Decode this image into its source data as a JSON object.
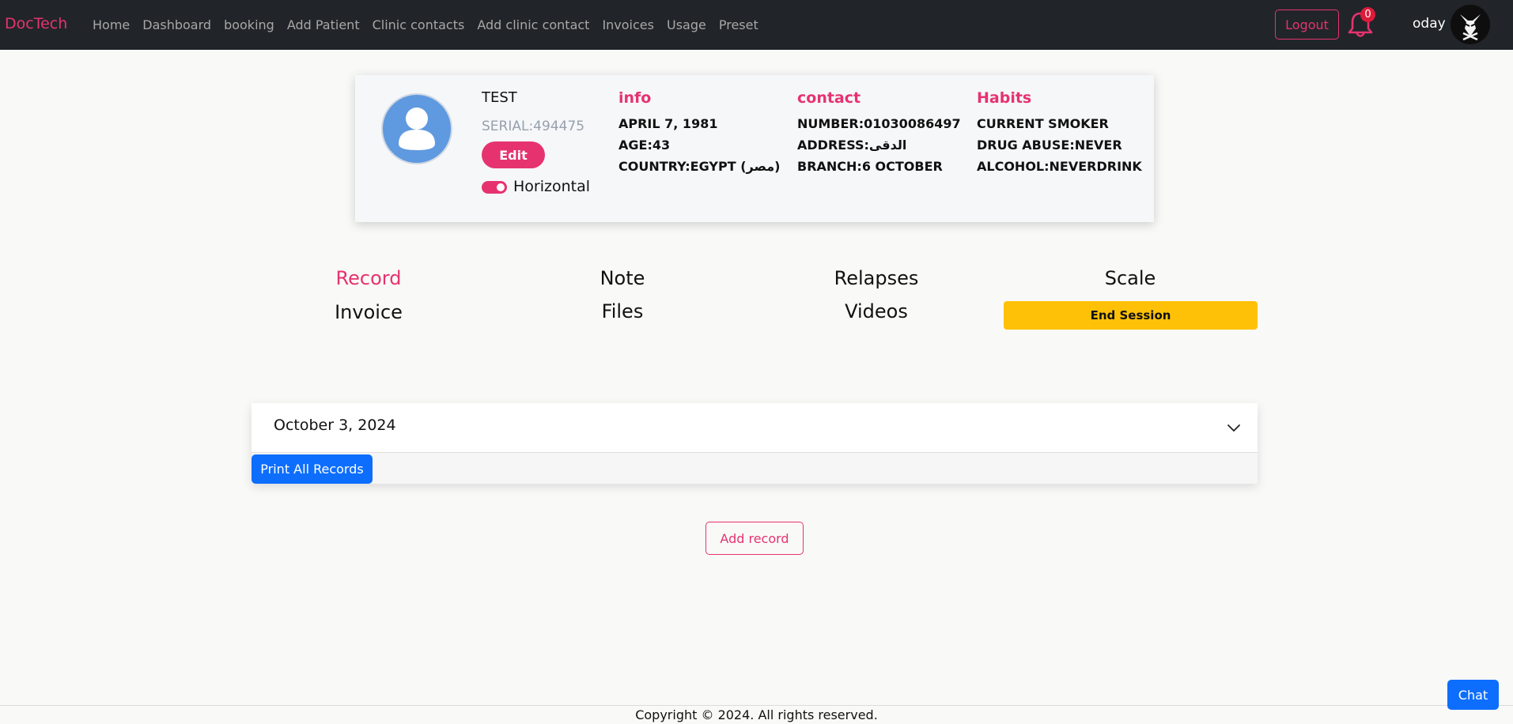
{
  "navbar": {
    "brand": "DocTech",
    "links": [
      "Home",
      "Dashboard",
      "booking",
      "Add Patient",
      "Clinic contacts",
      "Add clinic contact",
      "Invoices",
      "Usage",
      "Preset"
    ],
    "logout": "Logout",
    "notification_count": "0",
    "username": "oday"
  },
  "patient": {
    "name": "TEST",
    "serial": "SERIAL:494475",
    "edit_label": "Edit",
    "toggle_label": "Horizontal",
    "info": {
      "heading": "info",
      "lines": [
        "APRIL 7, 1981",
        "AGE:43",
        "COUNTRY:EGYPT (مصر)"
      ]
    },
    "contact": {
      "heading": "contact",
      "lines": [
        "NUMBER:01030086497",
        "ADDRESS:الدقى",
        "BRANCH:6 OCTOBER"
      ]
    },
    "habits": {
      "heading": "Habits",
      "lines": [
        "CURRENT SMOKER",
        "DRUG ABUSE:NEVER",
        "ALCOHOL:NEVERDRINK"
      ]
    }
  },
  "tabs": {
    "record": "Record",
    "note": "Note",
    "relapses": "Relapses",
    "scale": "Scale",
    "invoice": "Invoice",
    "files": "Files",
    "videos": "Videos",
    "end_session": "End Session"
  },
  "records": {
    "date": "October 3, 2024",
    "print_all": "Print All Records",
    "add_record": "Add record"
  },
  "footer": {
    "copyright": "Copyright © 2024. All rights reserved."
  },
  "chat": "Chat",
  "colors": {
    "accent": "#e6336f",
    "navbar": "#212529",
    "primary": "#0d6efd",
    "warning": "#ffc107"
  }
}
